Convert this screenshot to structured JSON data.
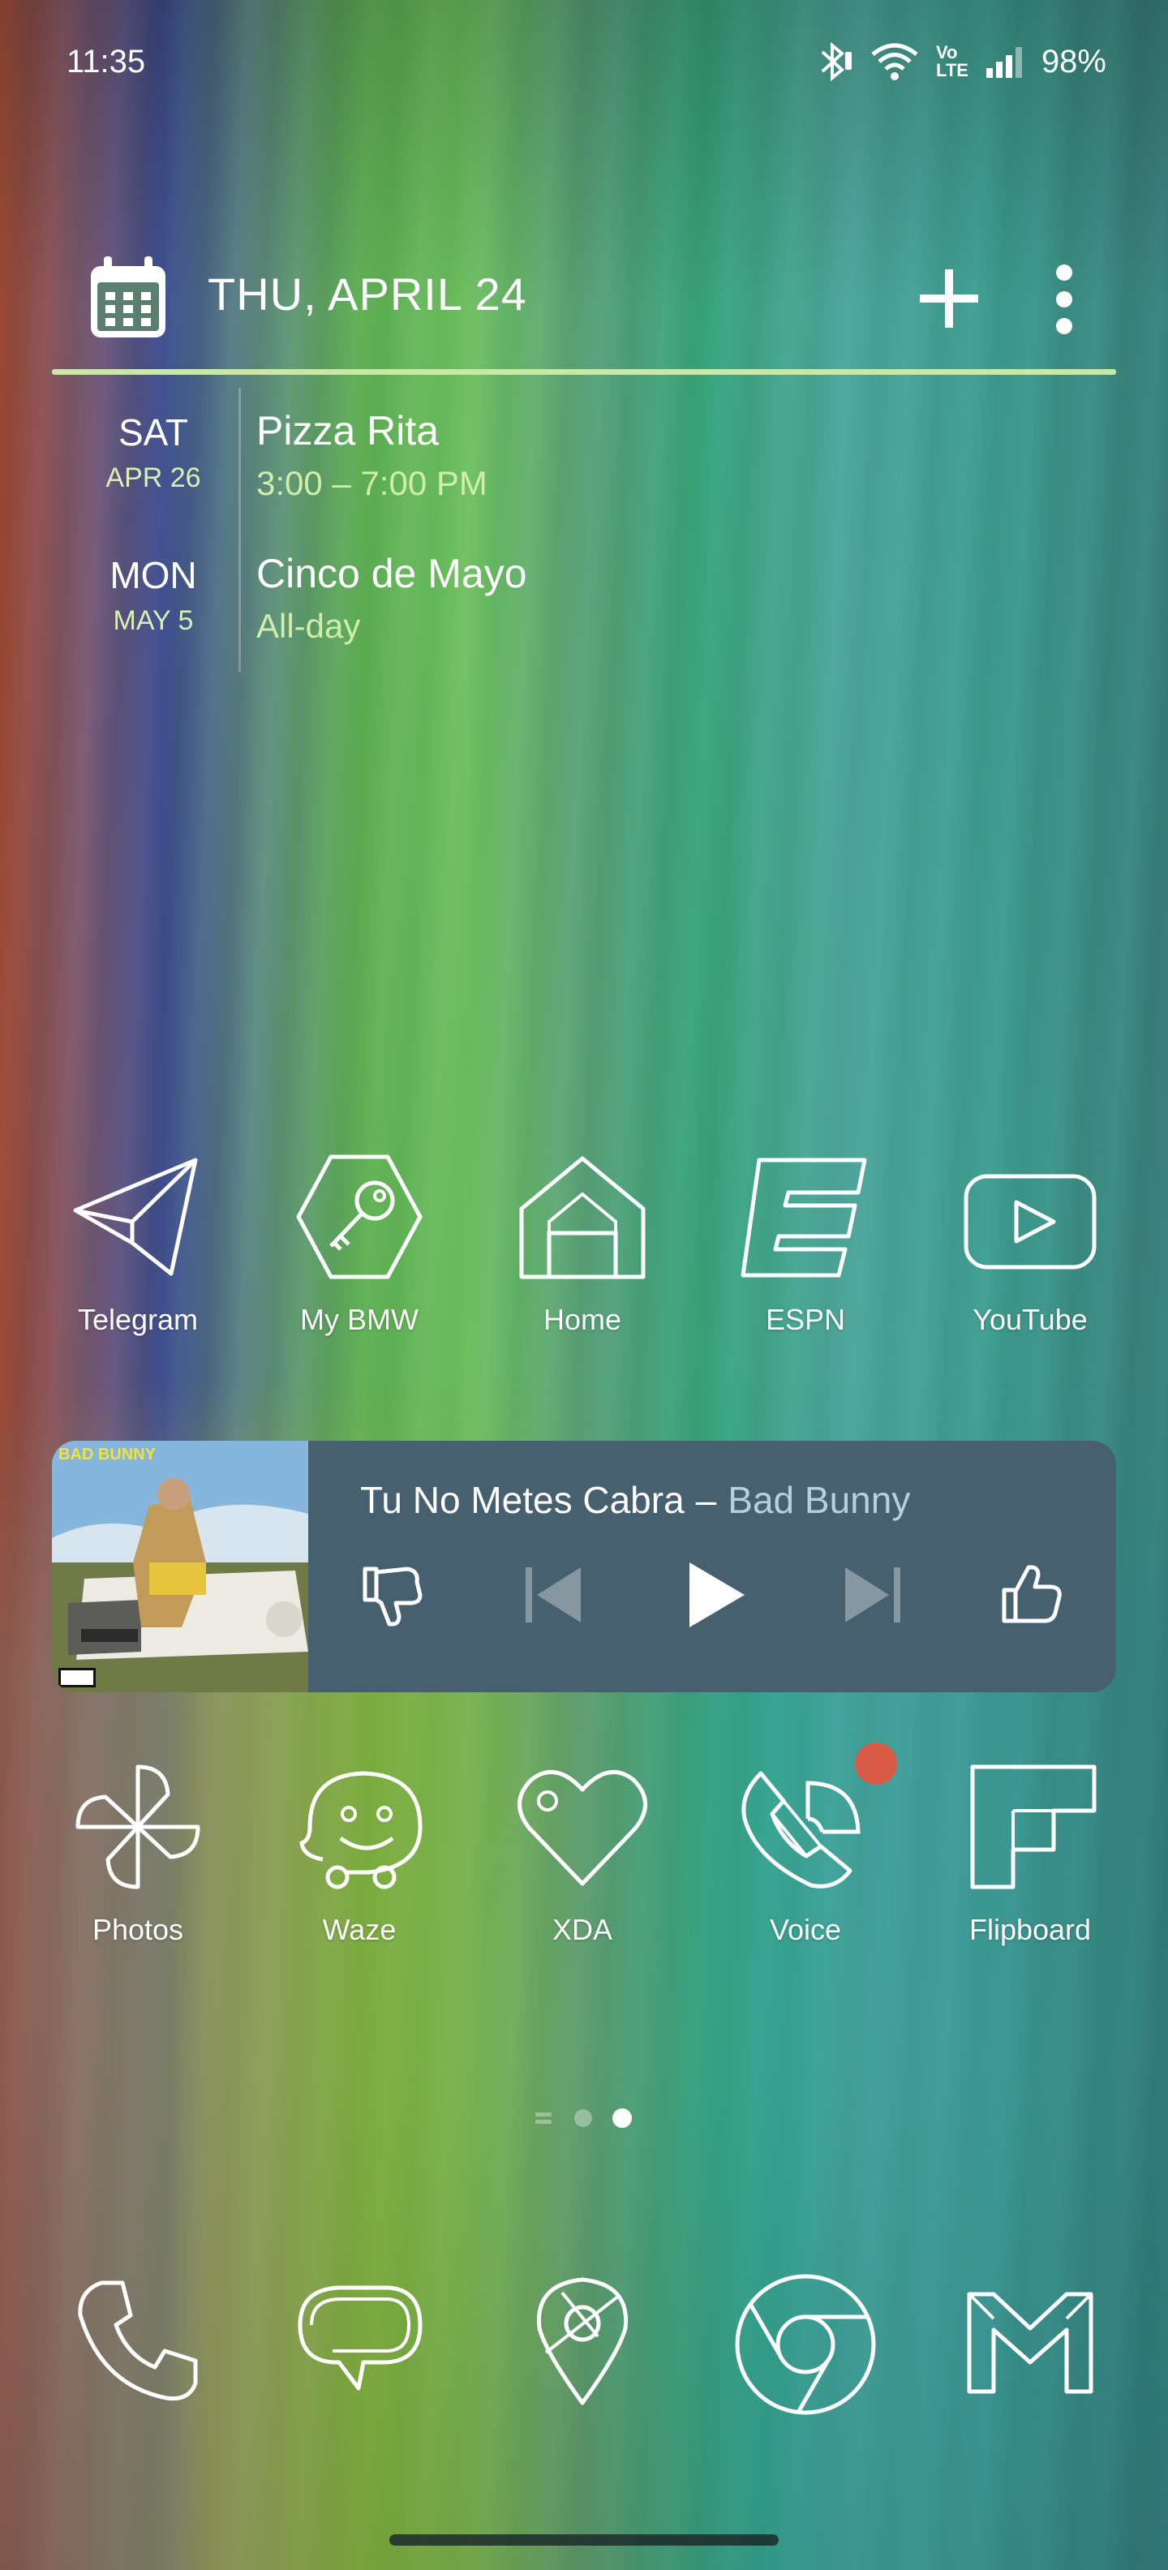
{
  "status_bar": {
    "time": "11:35",
    "volte_top": "Vo",
    "volte_bottom": "LTE",
    "battery": "98%"
  },
  "calendar": {
    "date": "THU, APRIL 24",
    "events": [
      {
        "dow": "SAT",
        "day": "APR 26",
        "title": "Pizza Rita",
        "time": "3:00 – 7:00 PM"
      },
      {
        "dow": "MON",
        "day": "MAY 5",
        "title": "Cinco de Mayo",
        "time": "All-day"
      }
    ]
  },
  "apps_row1": [
    {
      "label": "Telegram",
      "icon": "telegram-icon"
    },
    {
      "label": "My BMW",
      "icon": "key-icon"
    },
    {
      "label": "Home",
      "icon": "home-icon"
    },
    {
      "label": "ESPN",
      "icon": "espn-icon"
    },
    {
      "label": "YouTube",
      "icon": "youtube-icon"
    }
  ],
  "music": {
    "album_text": "BAD BUNNY",
    "song": "Tu No Metes Cabra",
    "separator": "–",
    "artist": "Bad Bunny"
  },
  "apps_row2": [
    {
      "label": "Photos",
      "icon": "photos-icon"
    },
    {
      "label": "Waze",
      "icon": "waze-icon"
    },
    {
      "label": "XDA",
      "icon": "heart-icon"
    },
    {
      "label": "Voice",
      "icon": "voice-icon",
      "badge": true
    },
    {
      "label": "Flipboard",
      "icon": "flipboard-icon"
    }
  ],
  "dock": [
    {
      "icon": "phone-icon"
    },
    {
      "icon": "messages-icon"
    },
    {
      "icon": "maps-icon"
    },
    {
      "icon": "chrome-icon"
    },
    {
      "icon": "gmail-icon"
    }
  ],
  "page_indicator": {
    "pages": 3,
    "active": 2
  },
  "colors": {
    "accent": "#c9e8a6",
    "music_panel": "#46606f",
    "badge": "#d95a45"
  }
}
